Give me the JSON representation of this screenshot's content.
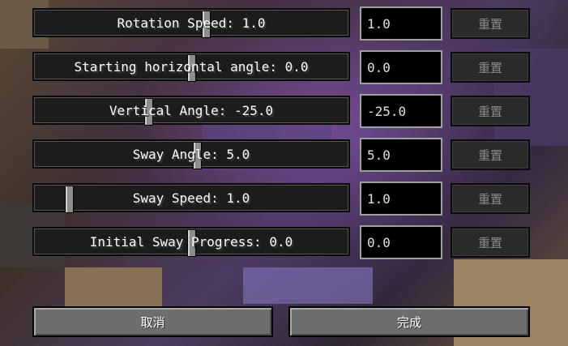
{
  "rows": [
    {
      "label": "Rotation Speed: 1.0",
      "value": "1.0",
      "reset": "重置",
      "fraction": 0.55
    },
    {
      "label": "Starting horizontal angle: 0.0",
      "value": "0.0",
      "reset": "重置",
      "fraction": 0.5
    },
    {
      "label": "Vertical Angle: -25.0",
      "value": "-25.0",
      "reset": "重置",
      "fraction": 0.36
    },
    {
      "label": "Sway Angle: 5.0",
      "value": "5.0",
      "reset": "重置",
      "fraction": 0.52
    },
    {
      "label": "Sway Speed: 1.0",
      "value": "1.0",
      "reset": "重置",
      "fraction": 0.1
    },
    {
      "label": "Initial Sway Progress: 0.0",
      "value": "0.0",
      "reset": "重置",
      "fraction": 0.5
    }
  ],
  "buttons": {
    "cancel": "取消",
    "done": "完成"
  }
}
